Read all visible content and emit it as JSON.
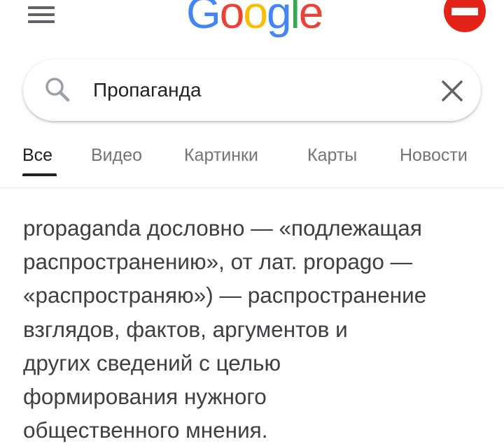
{
  "header": {
    "logo_letters": [
      "G",
      "o",
      "o",
      "g",
      "l",
      "e"
    ],
    "logo_colors": [
      "#4285F4",
      "#EA4335",
      "#FBBC05",
      "#4285F4",
      "#34A853",
      "#EA4335"
    ],
    "menu_icon": "hamburger-menu-icon",
    "account_icon": "no-entry-avatar-icon",
    "account_color": "#e2231a"
  },
  "search": {
    "value": "Пропаганда",
    "search_icon": "search-icon",
    "clear_icon": "close-icon"
  },
  "tabs": [
    {
      "label": "Все",
      "active": true
    },
    {
      "label": "Видео",
      "active": false
    },
    {
      "label": "Картинки",
      "active": false
    },
    {
      "label": "Карты",
      "active": false
    },
    {
      "label": "Новости",
      "active": false
    }
  ],
  "snippet": {
    "lines": [
      "propaganda дословно — «подлежащая",
      "распространению», от лат. propago —",
      "«распространяю») — распространение",
      "взглядов, фактов, аргументов и",
      "других сведений с целью",
      "формирования нужного",
      "общественного мнения."
    ]
  }
}
